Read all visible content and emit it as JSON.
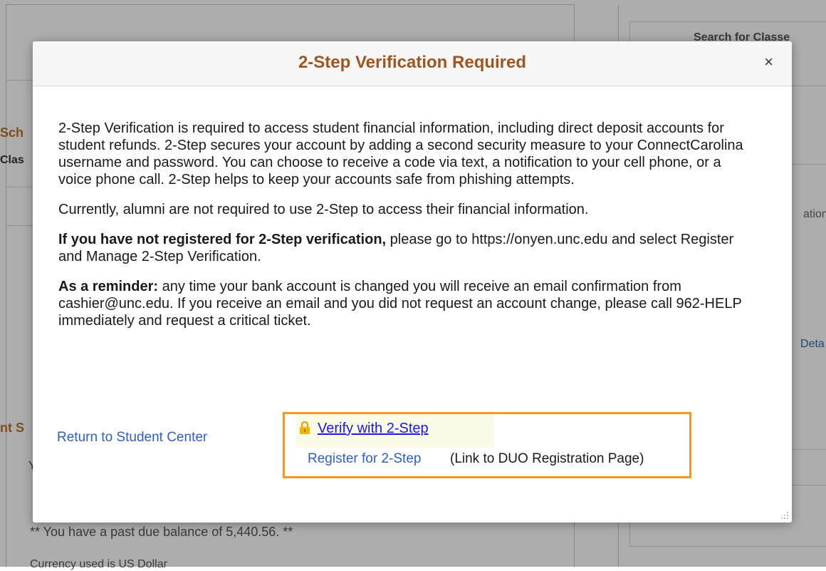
{
  "background": {
    "search_title": "Search for Classe",
    "sch": "Sch",
    "clas": "Clas",
    "ation": "ation",
    "deta": "Deta",
    "nts": "nt S",
    "y": "Y",
    "past_due": "** You have a past due balance of 5,440.56. **",
    "bottom": "Currency used is US Dollar"
  },
  "modal": {
    "title": "2-Step Verification Required",
    "close_label": "×",
    "paragraph1": "2-Step Verification is required to access student financial information, including direct deposit accounts for student refunds. 2-Step secures your account by adding a second security measure to your ConnectCarolina username and password. You can choose to receive a code via text, a notification to your cell phone, or a voice phone call. 2-Step helps to keep your accounts safe from phishing attempts.",
    "paragraph2": "Currently, alumni are not required to use 2-Step to access their financial information.",
    "paragraph3_bold": "If you have not registered for 2-Step verification,",
    "paragraph3_rest": " please go to https://onyen.unc.edu and select Register and Manage 2-Step Verification.",
    "paragraph4_bold": "As a reminder:",
    "paragraph4_rest": " any time your bank account is changed you will receive an email confirmation from cashier@unc.edu. If you receive an email and you did not request an account change, please call 962-HELP immediately and request a critical ticket.",
    "return_link": "Return to Student Center",
    "verify_link": "Verify with 2-Step",
    "register_link": "Register for 2-Step",
    "register_note": "(Link to DUO Registration Page)",
    "lock_icon": "lock-icon",
    "highlight_color": "#f39a1e",
    "title_color": "#a0551f"
  }
}
